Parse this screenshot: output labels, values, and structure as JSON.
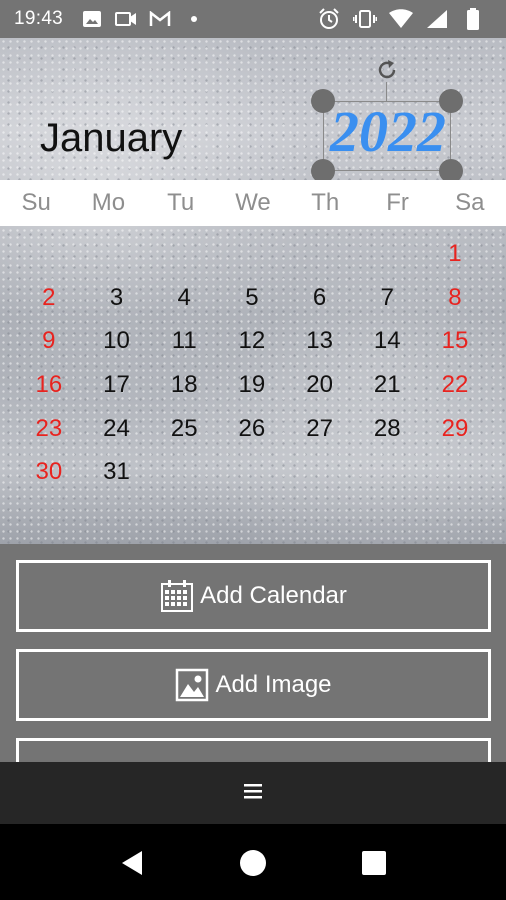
{
  "status_bar": {
    "time": "19:43",
    "left_icons": [
      "image-icon",
      "video-camera-icon",
      "gmail-icon",
      "dot-icon"
    ],
    "right_icons": [
      "alarm-icon",
      "vibrate-icon",
      "wifi-icon",
      "signal-icon",
      "battery-icon"
    ]
  },
  "calendar": {
    "month": "January",
    "year": "2022",
    "year_color": "#3a8ff0",
    "weekdays": [
      "Su",
      "Mo",
      "Tu",
      "We",
      "Th",
      "Fr",
      "Sa"
    ],
    "weeks": [
      [
        "",
        "",
        "",
        "",
        "",
        "",
        "1"
      ],
      [
        "2",
        "3",
        "4",
        "5",
        "6",
        "7",
        "8"
      ],
      [
        "9",
        "10",
        "11",
        "12",
        "13",
        "14",
        "15"
      ],
      [
        "16",
        "17",
        "18",
        "19",
        "20",
        "21",
        "22"
      ],
      [
        "23",
        "24",
        "25",
        "26",
        "27",
        "28",
        "29"
      ],
      [
        "30",
        "31",
        "",
        "",
        "",
        "",
        ""
      ]
    ],
    "weekend_color": "#e8231f"
  },
  "actions": {
    "add_calendar": "Add Calendar",
    "add_image": "Add Image"
  },
  "menu": {
    "icon": "hamburger-menu-icon",
    "label": "≡"
  },
  "nav": {
    "icons": [
      "back-icon",
      "home-icon",
      "recents-icon"
    ]
  }
}
